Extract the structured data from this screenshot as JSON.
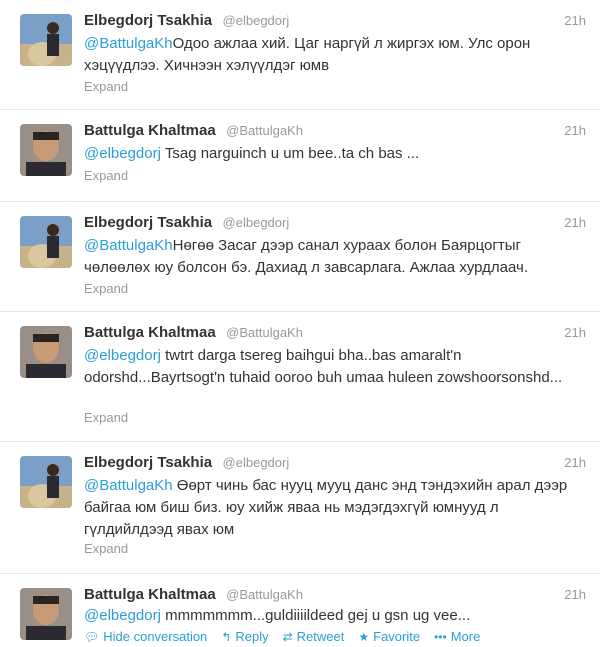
{
  "tweets": [
    {
      "fullname": "Elbegdorj Tsakhia",
      "username": "@elbegdorj",
      "time": "21h",
      "mention": "@BattulgaKh",
      "body": "Одоо ажлаа хий. Цаг наргүй л жиргэх юм. Улс орон хэцүүдлээ. Хичнээн хэлүүлдэг юмв",
      "expand": "Expand"
    },
    {
      "fullname": "Battulga Khaltmaa",
      "username": "@BattulgaKh",
      "time": "21h",
      "mention": "@elbegdorj",
      "body": " Tsag narguinch u um bee..ta ch bas ...",
      "expand": "Expand"
    },
    {
      "fullname": "Elbegdorj Tsakhia",
      "username": "@elbegdorj",
      "time": "21h",
      "mention": "@BattulgaKh",
      "body": "Нөгөө Засаг дээр санал хураах болон Баярцогтыг чөлөөлөх юу болсон бэ. Дахиад л завсарлага. Ажлаа хурдлаач.",
      "expand": "Expand"
    },
    {
      "fullname": "Battulga Khaltmaa",
      "username": "@BattulgaKh",
      "time": "21h",
      "mention": "@elbegdorj",
      "body": " twtrt darga tsereg baihgui bha..bas amaralt'n odorshd...Bayrtsogt'n tuhaid ooroo buh umaa huleen zowshoorsonshd...",
      "expand": "Expand"
    },
    {
      "fullname": "Elbegdorj Tsakhia",
      "username": "@elbegdorj",
      "time": "21h",
      "mention": "@BattulgaKh",
      "body": " Өөрт чинь бас нууц мууц данс энд тэндэхийн арал дээр байгаа юм биш биз. юу хийж яваа нь мэдэгдэхгүй юмнууд л гүлдийлдээд явах юм",
      "expand": "Expand"
    },
    {
      "fullname": "Battulga Khaltmaa",
      "username": "@BattulgaKh",
      "time": "21h",
      "mention": "@elbegdorj",
      "body": " mmmmmmm...guldiiiildeed gej u gsn ug vee...",
      "actions": {
        "hide": "Hide conversation",
        "reply": "Reply",
        "retweet": "Retweet",
        "favorite": "Favorite",
        "more": "More"
      }
    }
  ],
  "icons": {
    "hide": "speech-bubble-icon",
    "reply": "reply-arrow-icon",
    "retweet": "retweet-icon",
    "favorite": "star-icon",
    "more": "ellipsis-icon"
  },
  "colors": {
    "link": "#2a9fd6",
    "name": "#333333",
    "meta": "#999999",
    "divider": "#e1e8ed"
  }
}
